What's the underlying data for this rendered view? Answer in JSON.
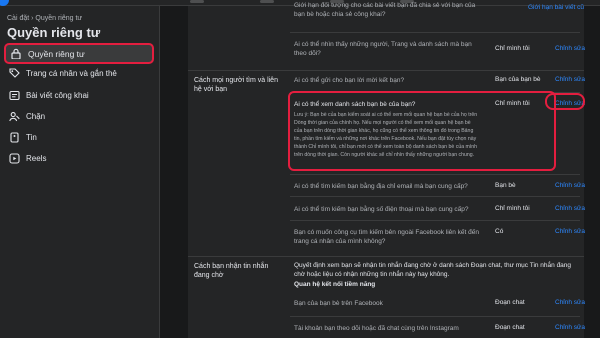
{
  "sidebar": {
    "breadcrumb": "Cài đặt › Quyền riêng tư",
    "title": "Quyền riêng tư",
    "items": [
      {
        "label": "Quyền riêng tư",
        "icon": "lock-icon",
        "active": true
      },
      {
        "label": "Trang cá nhân và gắn thẻ",
        "icon": "profile-tag-icon"
      },
      {
        "label": "Bài viết công khai",
        "icon": "globe-icon"
      },
      {
        "label": "Chặn",
        "icon": "block-icon"
      },
      {
        "label": "Tin",
        "icon": "story-icon"
      },
      {
        "label": "Reels",
        "icon": "reels-icon"
      }
    ]
  },
  "main": {
    "top_rows": [
      {
        "question": "Giới hạn đối tượng cho các bài viết bạn đã chia sẻ với bạn của bạn bè hoặc chia sẻ công khai?",
        "value": "",
        "edit": "Giới hạn bài viết cũ"
      },
      {
        "question": "Ai có thể nhìn thấy những người, Trang và danh sách mà bạn theo dõi?",
        "value": "Chỉ mình tôi",
        "edit": "Chỉnh sửa"
      }
    ],
    "section_contact": {
      "label": "Cách mọi người tìm và liên hệ với bạn",
      "rows": [
        {
          "question": "Ai có thể gửi cho bạn lời mời kết bạn?",
          "value": "Bạn của bạn bè",
          "edit": "Chỉnh sửa"
        },
        {
          "question": "Ai có thể xem danh sách bạn bè của bạn?",
          "description": "Lưu ý: Bạn bè của bạn kiểm soát ai có thể xem mối quan hệ bạn bè của họ trên Dòng thời gian của chính họ. Nếu mọi người có thể xem mối quan hệ bạn bè của bạn trên dòng thời gian khác, họ cũng có thể xem thông tin đó trong Bảng tin, phần tìm kiếm và những nơi khác trên Facebook. Nếu bạn đặt tùy chọn này thành Chỉ mình tôi, chỉ bạn mới có thể xem toàn bộ danh sách bạn bè của mình trên dòng thời gian. Còn người khác sẽ chỉ nhìn thấy những người bạn chung.",
          "value": "Chỉ mình tôi",
          "edit": "Chỉnh sửa"
        },
        {
          "question": "Ai có thể tìm kiếm bạn bằng địa chỉ email mà bạn cung cấp?",
          "value": "Bạn bè",
          "edit": "Chỉnh sửa"
        },
        {
          "question": "Ai có thể tìm kiếm bạn bằng số điện thoại mà bạn cung cấp?",
          "value": "Chỉ mình tôi",
          "edit": "Chỉnh sửa"
        },
        {
          "question": "Bạn có muốn công cụ tìm kiếm bên ngoài Facebook liên kết đến trang cá nhân của mình không?",
          "value": "Có",
          "edit": "Chỉnh sửa"
        }
      ]
    },
    "section_messages": {
      "label": "Cách bạn nhận tin nhắn đang chờ",
      "intro": "Quyết định xem bạn sẽ nhận tin nhắn đang chờ ở danh sách Đoạn chat, thư mục Tin nhắn đang chờ hoặc liệu có nhận những tin nhắn này hay không.",
      "subheading": "Quan hệ kết nối tiềm năng",
      "rows": [
        {
          "question": "Bạn của bạn bè trên Facebook",
          "value": "Đoạn chat",
          "edit": "Chỉnh sửa"
        },
        {
          "question": "Tài khoản bạn theo dõi hoặc đã chat cùng trên Instagram",
          "value": "Đoạn chat",
          "edit": "Chỉnh sửa"
        }
      ]
    }
  },
  "colors": {
    "accent": "#2d88ff",
    "highlight": "#e41e3f",
    "background": "#18191a",
    "panel": "#242526"
  }
}
